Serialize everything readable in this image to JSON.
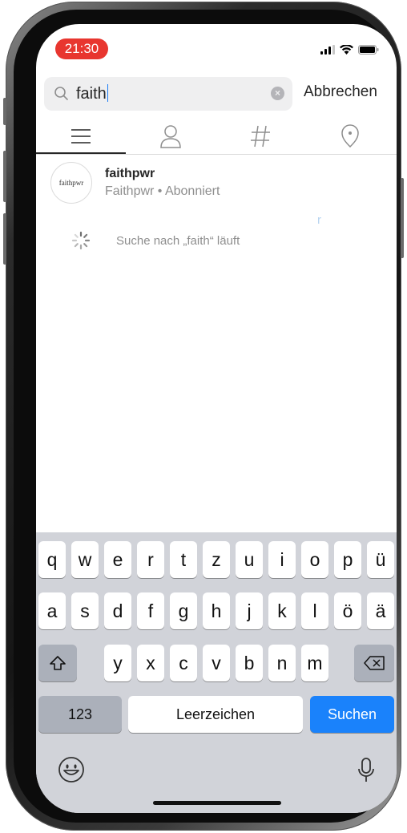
{
  "status_bar": {
    "time": "21:30"
  },
  "search": {
    "query": "faith",
    "cancel_label": "Abbrechen"
  },
  "tabs": [
    {
      "name": "top",
      "icon": "list-icon",
      "active": true
    },
    {
      "name": "accounts",
      "icon": "person-icon",
      "active": false
    },
    {
      "name": "tags",
      "icon": "hashtag-icon",
      "active": false
    },
    {
      "name": "places",
      "icon": "location-pin-icon",
      "active": false
    }
  ],
  "results": [
    {
      "avatar_text": "faithpwr",
      "username": "faithpwr",
      "subtitle": "Faithpwr • Abonniert"
    }
  ],
  "stray_char": "r",
  "loading": {
    "text": "Suche nach „faith“ läuft"
  },
  "keyboard": {
    "row1": [
      "q",
      "w",
      "e",
      "r",
      "t",
      "z",
      "u",
      "i",
      "o",
      "p",
      "ü"
    ],
    "row2": [
      "a",
      "s",
      "d",
      "f",
      "g",
      "h",
      "j",
      "k",
      "l",
      "ö",
      "ä"
    ],
    "row3": [
      "y",
      "x",
      "c",
      "v",
      "b",
      "n",
      "m"
    ],
    "numbers_label": "123",
    "space_label": "Leerzeichen",
    "return_label": "Suchen"
  },
  "colors": {
    "accent": "#1a82fb",
    "time_pill": "#e8362f"
  }
}
